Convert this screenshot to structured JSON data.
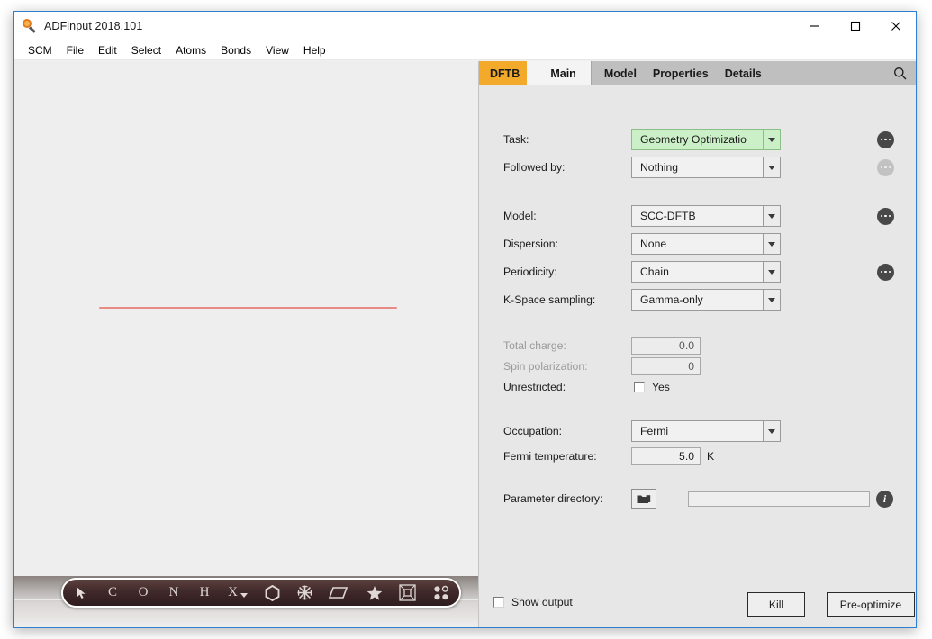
{
  "window": {
    "title": "ADFinput 2018.101",
    "app_icon": "magnifier-icon",
    "controls": {
      "minimize": "minimize-icon",
      "maximize": "maximize-icon",
      "close": "close-icon"
    }
  },
  "menubar": {
    "items": [
      "SCM",
      "File",
      "Edit",
      "Select",
      "Atoms",
      "Bonds",
      "View",
      "Help"
    ]
  },
  "viewer": {
    "toolbar": {
      "items": [
        {
          "label": "",
          "icon": "cursor-arrow-icon",
          "name": "tool-select"
        },
        {
          "label": "C",
          "icon": "",
          "name": "tool-carbon"
        },
        {
          "label": "O",
          "icon": "",
          "name": "tool-oxygen"
        },
        {
          "label": "N",
          "icon": "",
          "name": "tool-nitrogen"
        },
        {
          "label": "H",
          "icon": "",
          "name": "tool-hydrogen"
        },
        {
          "label": "X",
          "icon": "chevron-down-icon",
          "name": "tool-element-picker"
        },
        {
          "label": "",
          "icon": "hexagon-ring-icon",
          "name": "tool-benzene-ring"
        },
        {
          "label": "",
          "icon": "snowflake-icon",
          "name": "tool-fragment"
        },
        {
          "label": "",
          "icon": "plane-icon",
          "name": "tool-plane"
        },
        {
          "label": "",
          "icon": "star-icon",
          "name": "tool-favorites"
        },
        {
          "label": "",
          "icon": "cube-frame-icon",
          "name": "tool-crystal-cell"
        },
        {
          "label": "",
          "icon": "four-dots-icon",
          "name": "tool-points"
        }
      ]
    }
  },
  "panel": {
    "tabs": {
      "module": "DFTB",
      "active": "Main",
      "others": [
        "Model",
        "Properties",
        "Details"
      ],
      "search_icon": "search-icon"
    },
    "fields": {
      "task": {
        "label": "Task:",
        "value": "Geometry Optimizatio",
        "more": "more-options-icon"
      },
      "followed_by": {
        "label": "Followed by:",
        "value": "Nothing",
        "more": "more-options-icon"
      },
      "model": {
        "label": "Model:",
        "value": "SCC-DFTB",
        "more": "more-options-icon"
      },
      "dispersion": {
        "label": "Dispersion:",
        "value": "None"
      },
      "periodicity": {
        "label": "Periodicity:",
        "value": "Chain",
        "more": "more-options-icon"
      },
      "kspace": {
        "label": "K-Space sampling:",
        "value": "Gamma-only"
      },
      "total_charge": {
        "label": "Total charge:",
        "value": "0.0"
      },
      "spin_polarization": {
        "label": "Spin polarization:",
        "value": "0"
      },
      "unrestricted": {
        "label": "Unrestricted:",
        "checkbox_label": "Yes"
      },
      "occupation": {
        "label": "Occupation:",
        "value": "Fermi"
      },
      "fermi_temperature": {
        "label": "Fermi temperature:",
        "value": "5.0",
        "unit": "K"
      },
      "parameter_directory": {
        "label": "Parameter directory:",
        "browse_icon": "folder-icon",
        "value": "",
        "info": "info-icon"
      }
    }
  },
  "bottom": {
    "show_output_label": "Show output",
    "kill_label": "Kill",
    "preoptimize_label": "Pre-optimize"
  },
  "colors": {
    "accent_tab": "#f3a929",
    "task_highlight": "#cbf0c8",
    "chain_axis": "#e98b85",
    "window_border": "#2f7fd0"
  }
}
